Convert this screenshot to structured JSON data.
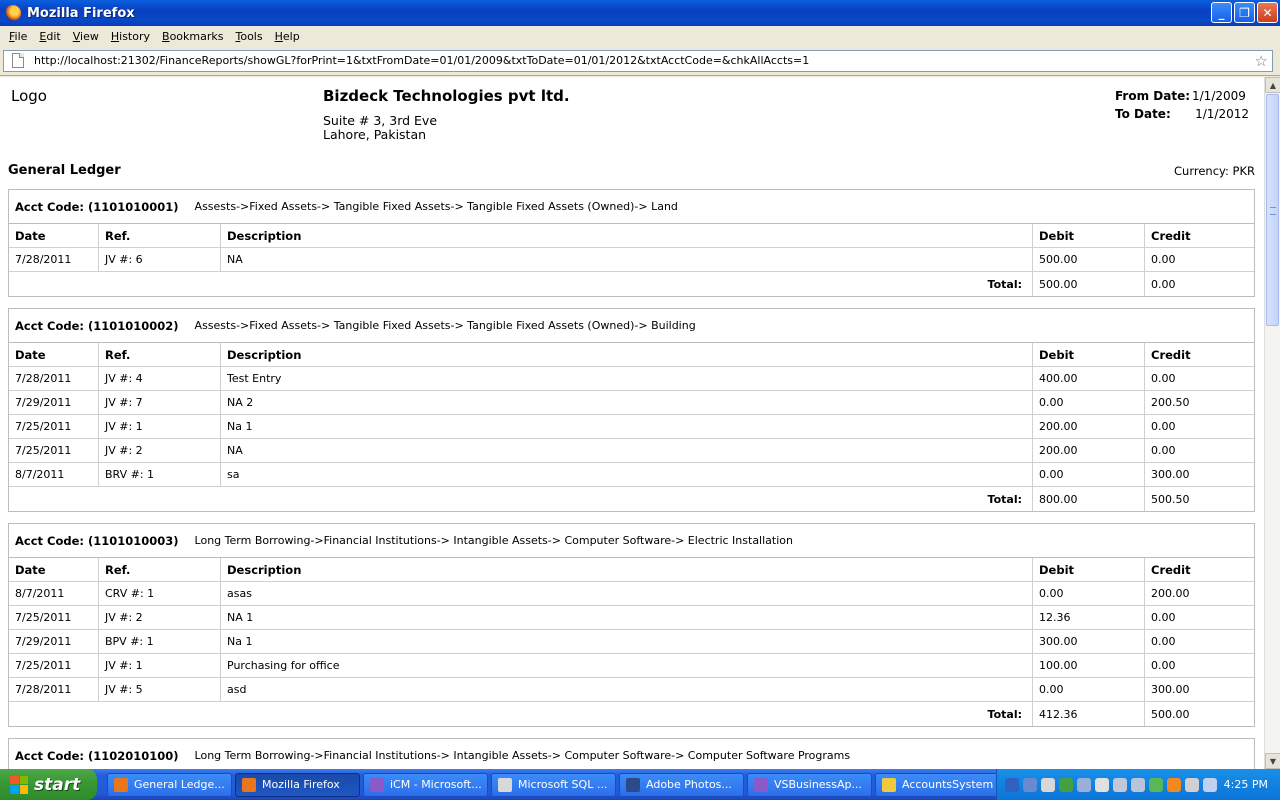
{
  "window": {
    "title": "Mozilla Firefox"
  },
  "menu": [
    "File",
    "Edit",
    "View",
    "History",
    "Bookmarks",
    "Tools",
    "Help"
  ],
  "address": {
    "url": "http://localhost:21302/FinanceReports/showGL?forPrint=1&txtFromDate=01/01/2009&txtToDate=01/01/2012&txtAcctCode=&chkAllAccts=1"
  },
  "report": {
    "logo": "Logo",
    "company": "Bizdeck Technologies pvt ltd.",
    "address_line1": "Suite # 3, 3rd Eve",
    "address_line2": "Lahore, Pakistan",
    "from_label": "From Date:",
    "from_value": "1/1/2009",
    "to_label": "To Date:",
    "to_value": "1/1/2012",
    "title": "General Ledger",
    "currency": "Currency: PKR",
    "columns": {
      "date": "Date",
      "ref": "Ref.",
      "desc": "Description",
      "debit": "Debit",
      "credit": "Credit"
    },
    "total_label": "Total:",
    "accounts": [
      {
        "code": "Acct Code: (1101010001)",
        "path": "Assests->Fixed Assets-> Tangible Fixed Assets-> Tangible Fixed Assets (Owned)-> Land",
        "rows": [
          {
            "date": "7/28/2011",
            "ref": "JV #: 6",
            "desc": "NA",
            "debit": "500.00",
            "credit": "0.00"
          }
        ],
        "total_debit": "500.00",
        "total_credit": "0.00"
      },
      {
        "code": "Acct Code: (1101010002)",
        "path": "Assests->Fixed Assets-> Tangible Fixed Assets-> Tangible Fixed Assets (Owned)-> Building",
        "rows": [
          {
            "date": "7/28/2011",
            "ref": "JV #: 4",
            "desc": "Test Entry",
            "debit": "400.00",
            "credit": "0.00"
          },
          {
            "date": "7/29/2011",
            "ref": "JV #: 7",
            "desc": "NA 2",
            "debit": "0.00",
            "credit": "200.50"
          },
          {
            "date": "7/25/2011",
            "ref": "JV #: 1",
            "desc": "Na 1",
            "debit": "200.00",
            "credit": "0.00"
          },
          {
            "date": "7/25/2011",
            "ref": "JV #: 2",
            "desc": "NA",
            "debit": "200.00",
            "credit": "0.00"
          },
          {
            "date": "8/7/2011",
            "ref": "BRV #: 1",
            "desc": "sa",
            "debit": "0.00",
            "credit": "300.00"
          }
        ],
        "total_debit": "800.00",
        "total_credit": "500.50"
      },
      {
        "code": "Acct Code: (1101010003)",
        "path": "Long Term Borrowing->Financial Institutions-> Intangible Assets-> Computer Software-> Electric Installation",
        "rows": [
          {
            "date": "8/7/2011",
            "ref": "CRV #: 1",
            "desc": "asas",
            "debit": "0.00",
            "credit": "200.00"
          },
          {
            "date": "7/25/2011",
            "ref": "JV #: 2",
            "desc": "NA 1",
            "debit": "12.36",
            "credit": "0.00"
          },
          {
            "date": "7/29/2011",
            "ref": "BPV #: 1",
            "desc": "Na 1",
            "debit": "300.00",
            "credit": "0.00"
          },
          {
            "date": "7/25/2011",
            "ref": "JV #: 1",
            "desc": "Purchasing for office",
            "debit": "100.00",
            "credit": "0.00"
          },
          {
            "date": "7/28/2011",
            "ref": "JV #: 5",
            "desc": "asd",
            "debit": "0.00",
            "credit": "300.00"
          }
        ],
        "total_debit": "412.36",
        "total_credit": "500.00"
      },
      {
        "code": "Acct Code: (1102010100)",
        "path": "Long Term Borrowing->Financial Institutions-> Intangible Assets-> Computer Software-> Computer Software Programs",
        "rows": [],
        "total_debit": "",
        "total_credit": ""
      }
    ]
  },
  "taskbar": {
    "start": "start",
    "tasks": [
      {
        "label": "General Ledge...",
        "icon": "firefox-icon",
        "active": false
      },
      {
        "label": "Mozilla Firefox",
        "icon": "firefox-icon",
        "active": true
      },
      {
        "label": "iCM - Microsoft...",
        "icon": "visual-studio-icon",
        "active": false
      },
      {
        "label": "Microsoft SQL ...",
        "icon": "sql-server-icon",
        "active": false
      },
      {
        "label": "Adobe Photos...",
        "icon": "photoshop-icon",
        "active": false
      },
      {
        "label": "VSBusinessAp...",
        "icon": "visual-studio-icon",
        "active": false
      },
      {
        "label": "AccountsSystem",
        "icon": "folder-icon",
        "active": false
      }
    ],
    "clock": "4:25 PM"
  }
}
